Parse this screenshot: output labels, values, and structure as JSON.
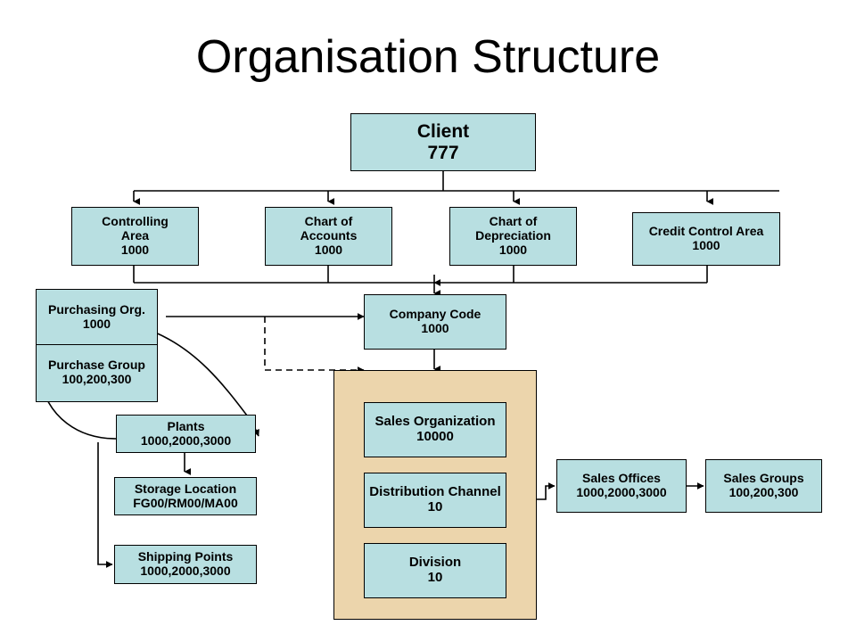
{
  "title": "Organisation Structure",
  "colors": {
    "node_fill": "#b8dfe1",
    "container_fill": "#ecd5ac",
    "border": "#000000",
    "background": "#ffffff"
  },
  "nodes": {
    "client": {
      "name": "Client",
      "value": "777"
    },
    "controlling_area": {
      "name": "Controlling",
      "name2": "Area",
      "value": "1000"
    },
    "chart_of_accounts": {
      "name": "Chart of",
      "name2": "Accounts",
      "value": "1000"
    },
    "chart_of_depreciation": {
      "name": "Chart of",
      "name2": "Depreciation",
      "value": "1000"
    },
    "credit_control_area": {
      "name": "Credit Control Area",
      "value": "1000"
    },
    "purchasing_org": {
      "name": "Purchasing Org.",
      "value": "1000"
    },
    "purchase_group": {
      "name": "Purchase Group",
      "value": "100,200,300"
    },
    "company_code": {
      "name": "Company Code",
      "value": "1000"
    },
    "plants": {
      "name": "Plants",
      "value": "1000,2000,3000"
    },
    "storage_location": {
      "name": "Storage Location",
      "value": "FG00/RM00/MA00"
    },
    "shipping_points": {
      "name": "Shipping Points",
      "value": "1000,2000,3000"
    },
    "sales_organization": {
      "name": "Sales Organization",
      "value": "10000"
    },
    "distribution_channel": {
      "name": "Distribution Channel",
      "value": "10"
    },
    "division": {
      "name": "Division",
      "value": "10"
    },
    "sales_offices": {
      "name": "Sales Offices",
      "value": "1000,2000,3000"
    },
    "sales_groups": {
      "name": "Sales Groups",
      "value": "100,200,300"
    }
  },
  "hierarchy": {
    "root": "client",
    "level2": [
      "controlling_area",
      "chart_of_accounts",
      "chart_of_depreciation",
      "credit_control_area"
    ],
    "level3": [
      "company_code"
    ],
    "sales_area_members": [
      "sales_organization",
      "distribution_channel",
      "division"
    ],
    "logistics": [
      "plants",
      "storage_location",
      "shipping_points"
    ],
    "purchasing": [
      "purchasing_org",
      "purchase_group"
    ]
  },
  "connectors": [
    {
      "from": "client",
      "to": "controlling_area",
      "style": "solid",
      "arrow": true
    },
    {
      "from": "client",
      "to": "chart_of_accounts",
      "style": "solid",
      "arrow": true
    },
    {
      "from": "client",
      "to": "chart_of_depreciation",
      "style": "solid",
      "arrow": true
    },
    {
      "from": "client",
      "to": "credit_control_area",
      "style": "solid",
      "arrow": true
    },
    {
      "from": "level2-bus",
      "to": "company_code",
      "style": "solid",
      "arrow": true
    },
    {
      "from": "company_code",
      "to": "purchasing_org",
      "style": "solid",
      "arrow": true
    },
    {
      "from": "company_code",
      "to": "purchase_group",
      "style": "dashed",
      "arrow": true
    },
    {
      "from": "company_code",
      "to": "plants",
      "style": "curved",
      "arrow": true
    },
    {
      "from": "company_code",
      "to": "sales_area",
      "style": "solid",
      "arrow": true
    },
    {
      "from": "plants",
      "to": "purchasing_org",
      "style": "curved",
      "arrow": true
    },
    {
      "from": "plants",
      "to": "storage_location",
      "style": "solid",
      "arrow": true
    },
    {
      "from": "plants",
      "to": "shipping_points",
      "style": "solid",
      "arrow": true
    },
    {
      "from": "sales_area",
      "to": "sales_offices",
      "style": "solid",
      "arrow": true
    },
    {
      "from": "sales_offices",
      "to": "sales_groups",
      "style": "solid",
      "arrow": true
    }
  ]
}
